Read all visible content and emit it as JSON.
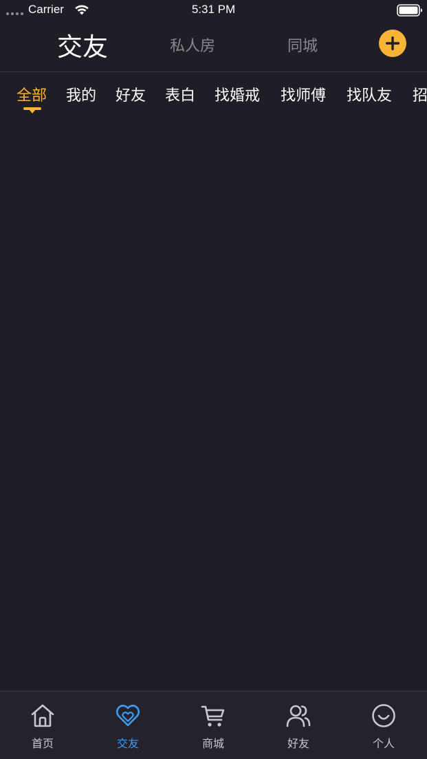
{
  "status_bar": {
    "carrier": "Carrier",
    "time": "5:31 PM"
  },
  "header": {
    "tabs": [
      {
        "label": "交友",
        "active": true
      },
      {
        "label": "私人房",
        "active": false
      },
      {
        "label": "同城",
        "active": false
      }
    ],
    "add_icon": "plus-icon"
  },
  "categories": {
    "items": [
      "全部",
      "我的",
      "好友",
      "表白",
      "找婚戒",
      "找师傅",
      "找队友",
      "招"
    ],
    "selected": "全部"
  },
  "tab_bar": {
    "items": [
      {
        "label": "首页",
        "icon": "home-icon",
        "active": false
      },
      {
        "label": "交友",
        "icon": "heart-icon",
        "active": true
      },
      {
        "label": "商城",
        "icon": "cart-icon",
        "active": false
      },
      {
        "label": "好友",
        "icon": "friends-icon",
        "active": false
      },
      {
        "label": "个人",
        "icon": "smile-icon",
        "active": false
      }
    ]
  },
  "colors": {
    "background": "#1f1e27",
    "accent": "#f7b538",
    "active_tab": "#3d9bf2",
    "inactive_text": "#8a8990"
  }
}
